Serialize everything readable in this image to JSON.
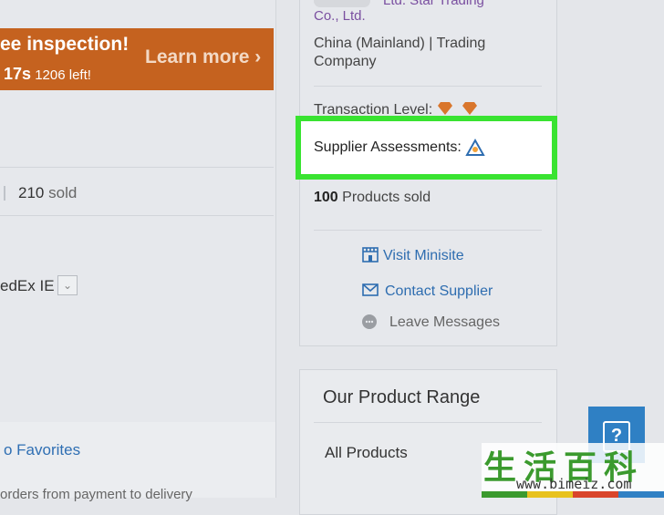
{
  "left": {
    "promo": {
      "title": "ee inspection!",
      "timer_strong": "17s",
      "timer_rest": "1206 left!",
      "learn_more": "Learn more ›"
    },
    "sold": {
      "count": "210",
      "label": "sold"
    },
    "shipping": {
      "value": "edEx IE"
    },
    "favorites": "o Favorites",
    "orders_text": "orders from payment to delivery"
  },
  "supplier": {
    "company_line1": "Ltd. Star Trading",
    "company_line2": "Co., Ltd.",
    "location": "China (Mainland) | Trading Company",
    "transaction_level_label": "Transaction Level:",
    "assessments_label": "Supplier Assessments:",
    "products_sold_count": "100",
    "products_sold_label": "Products sold",
    "visit_minisite": "Visit Minisite",
    "contact_supplier": "Contact Supplier",
    "leave_messages": "Leave Messages"
  },
  "product_range": {
    "title": "Our Product Range",
    "all_products": "All Products"
  },
  "help": {
    "glyph": "?"
  },
  "watermark": {
    "chars": "生活百科",
    "url": "www.bimeiz.com"
  },
  "colors": {
    "promo_bg": "#c5621f",
    "highlight": "#39e331",
    "link": "#2e6db0",
    "help_bg": "#2f80c4"
  }
}
